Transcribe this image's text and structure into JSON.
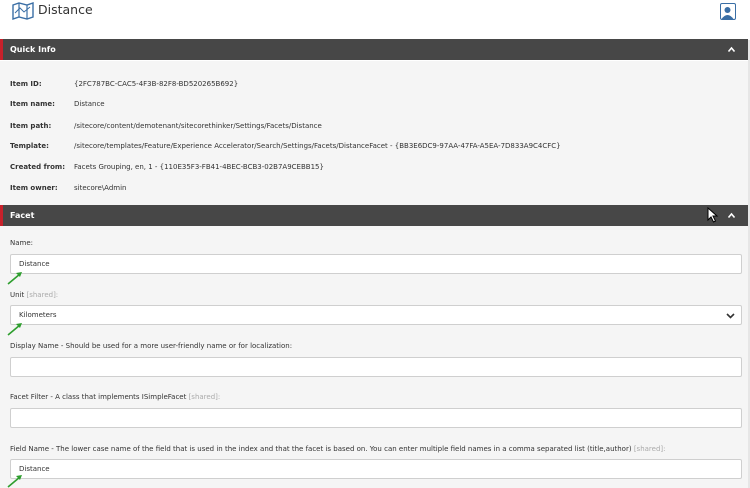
{
  "titlebar": {
    "title": "Distance",
    "icon": "map-icon",
    "user_icon": "user-avatar-icon"
  },
  "quick_info": {
    "header": "Quick Info",
    "rows": [
      {
        "label": "Item ID:",
        "value": "{2FC787BC-CAC5-4F3B-82F8-BD520265B692}"
      },
      {
        "label": "Item name:",
        "value": "Distance"
      },
      {
        "label": "Item path:",
        "value": "/sitecore/content/demotenant/sitecorethinker/Settings/Facets/Distance"
      },
      {
        "label": "Template:",
        "value": "/sitecore/templates/Feature/Experience Accelerator/Search/Settings/Facets/DistanceFacet - {BB3E6DC9-97AA-47FA-A5EA-7D833A9C4CFC}"
      },
      {
        "label": "Created from:",
        "value": "Facets Grouping, en, 1 - {110E35F3-FB41-4BEC-BCB3-02B7A9CEBB15}"
      },
      {
        "label": "Item owner:",
        "value": "sitecore\\Admin"
      }
    ]
  },
  "facet": {
    "header": "Facet",
    "name": {
      "label": "Name:",
      "value": "Distance"
    },
    "unit": {
      "label": "Unit",
      "shared": "[shared]:",
      "value": "Kilometers"
    },
    "display_name": {
      "label": "Display Name - Should be used for a more user-friendly name or for localization:",
      "value": ""
    },
    "facet_filter": {
      "label": "Facet Filter - A class that implements ISimpleFacet",
      "shared": "[shared]:",
      "value": ""
    },
    "field_name": {
      "label": "Field Name - The lower case name of the field that is used in the index and that the facet is based on. You can enter multiple field names in a comma separated list (title,author)",
      "shared": "[shared]:",
      "value": "Distance"
    }
  },
  "colors": {
    "header_bg": "#474747",
    "accent_red": "#c8212b",
    "arrow_green": "#2e9e2e",
    "panel_bg": "#f5f5f5"
  }
}
